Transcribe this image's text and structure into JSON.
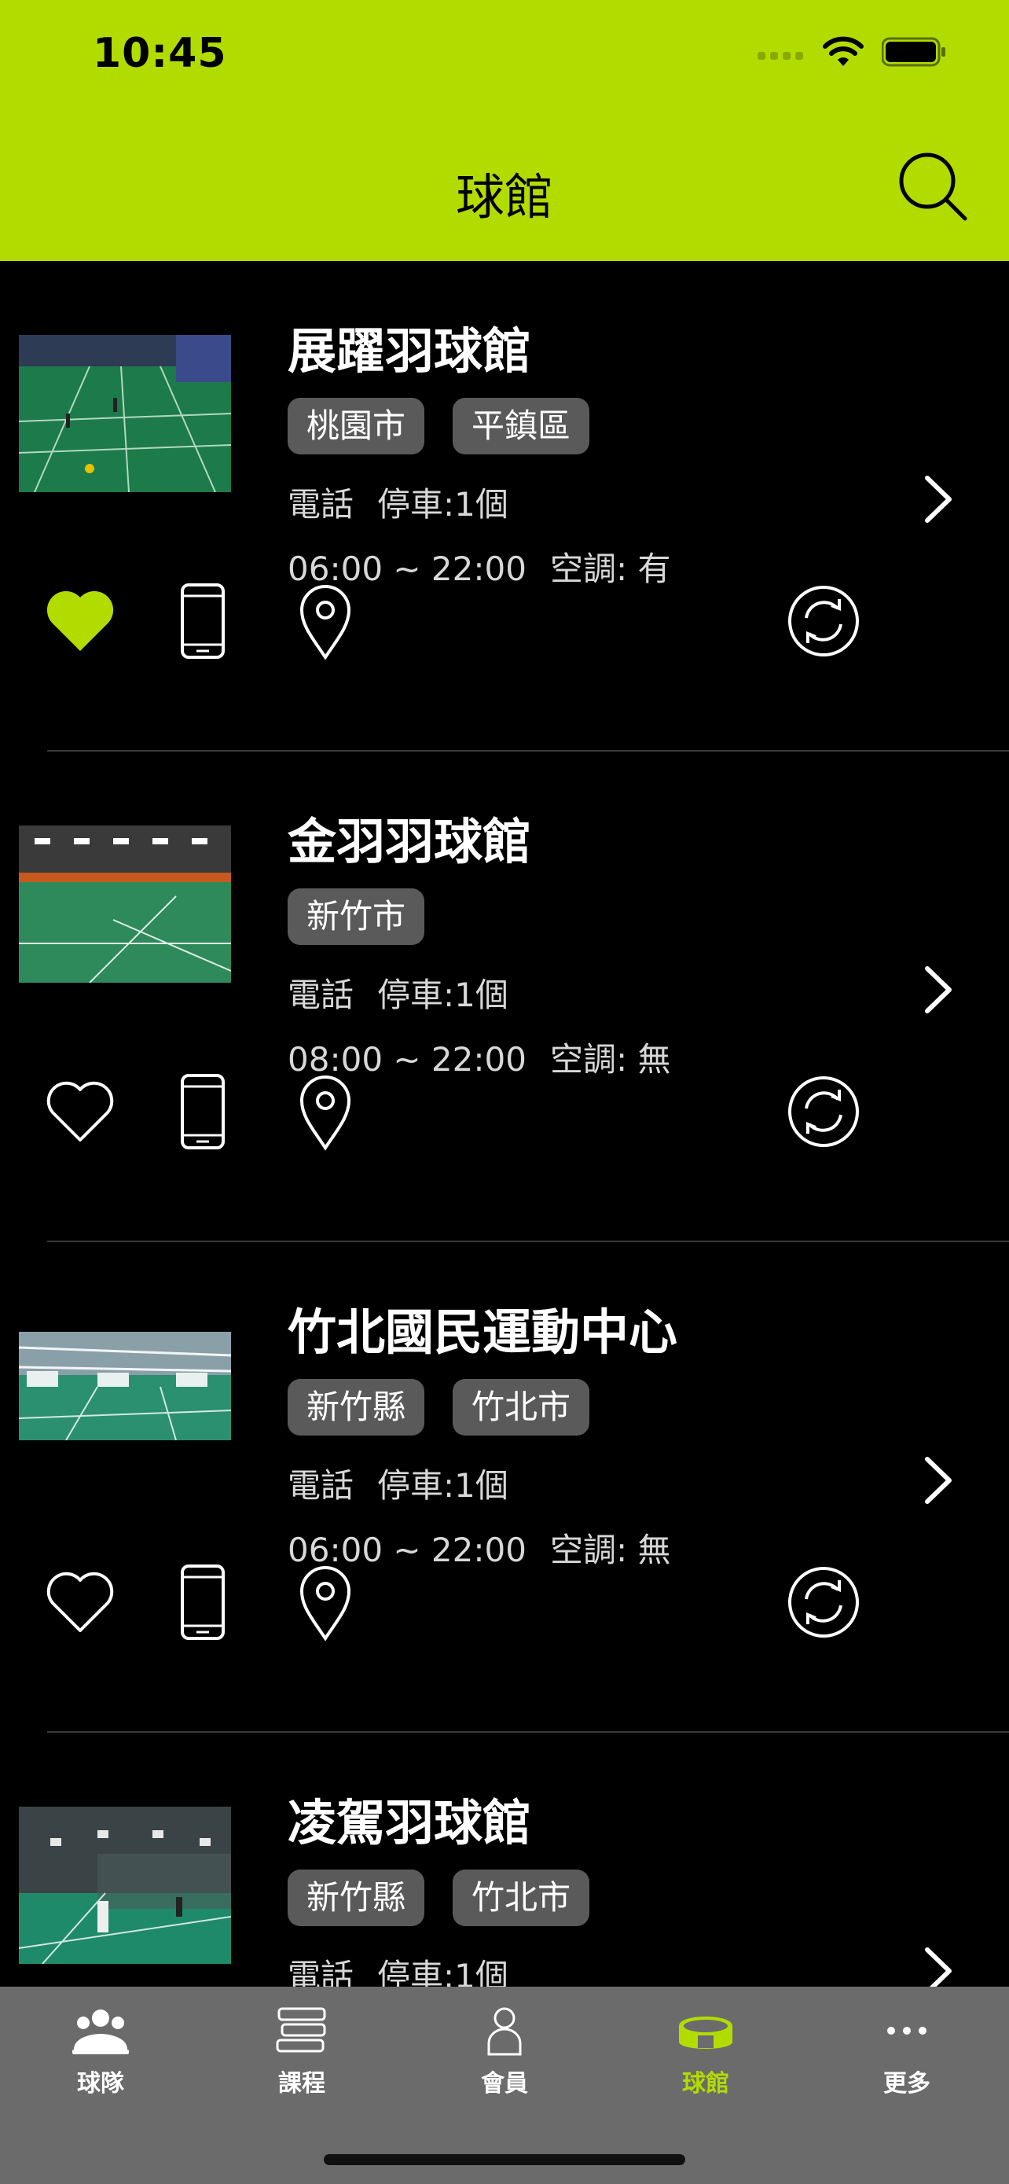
{
  "status": {
    "time": "10:45"
  },
  "header": {
    "title": "球館"
  },
  "colors": {
    "accent": "#b2dc00",
    "tabbar": "#6b6b6b",
    "tag": "#5a5a5a"
  },
  "venues": [
    {
      "name": "展躍羽球館",
      "tags": [
        "桃園市",
        "平鎮區"
      ],
      "phone": "電話",
      "parking": "停車:1個",
      "hours": "06:00 ~ 22:00",
      "ac": "空調: 有",
      "favorited": true
    },
    {
      "name": "金羽羽球館",
      "tags": [
        "新竹市"
      ],
      "phone": "電話",
      "parking": "停車:1個",
      "hours": "08:00 ~ 22:00",
      "ac": "空調: 無",
      "favorited": false
    },
    {
      "name": "竹北國民運動中心",
      "tags": [
        "新竹縣",
        "竹北市"
      ],
      "phone": "電話",
      "parking": "停車:1個",
      "hours": "06:00 ~ 22:00",
      "ac": "空調: 無",
      "favorited": false
    },
    {
      "name": "凌駕羽球館",
      "tags": [
        "新竹縣",
        "竹北市"
      ],
      "phone": "電話",
      "parking": "停車:1個",
      "hours": "",
      "ac": "",
      "favorited": false
    }
  ],
  "tabbar": {
    "items": [
      {
        "label": "球隊",
        "icon": "team-icon"
      },
      {
        "label": "課程",
        "icon": "books-icon"
      },
      {
        "label": "會員",
        "icon": "member-icon"
      },
      {
        "label": "球館",
        "icon": "stadium-icon",
        "active": true
      },
      {
        "label": "更多",
        "icon": "more-icon"
      }
    ]
  }
}
